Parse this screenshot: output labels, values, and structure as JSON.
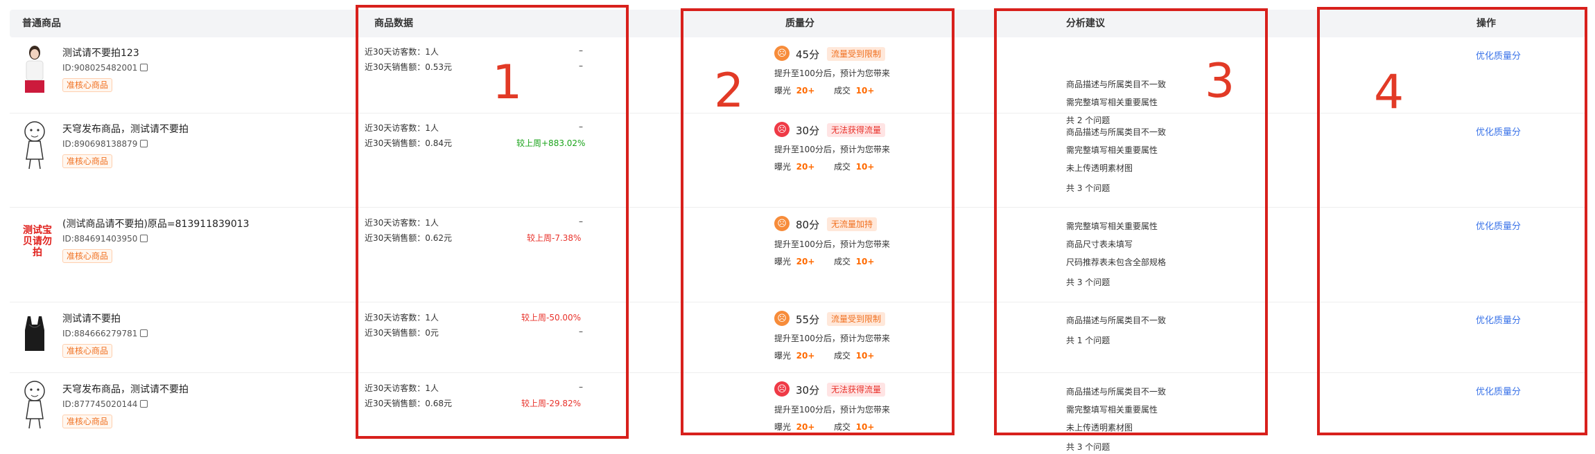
{
  "header": {
    "product": "普通商品",
    "data": "商品数据",
    "quality": "质量分",
    "suggest": "分析建议",
    "action": "操作"
  },
  "rows": [
    {
      "name": "测试请不要拍123",
      "id": "ID:908025482001",
      "tag": "准核心商品",
      "visitors_label": "近30天访客数：1人",
      "visitors_change": "–",
      "sales_label": "近30天销售额：0.53元",
      "sales_change": "–",
      "score": "45分",
      "status": "流量受到限制",
      "promo": "提升至100分后，预计为您带来",
      "exposure_label": "曝光",
      "exposure_value": "20+",
      "deal_label": "成交",
      "deal_value": "10+",
      "suggestions": [
        "商品描述与所属类目不一致",
        "需完整填写相关重要属性"
      ],
      "issue_count": "共 2 个问题",
      "action": "优化质量分"
    },
    {
      "name": "天穹发布商品，测试请不要拍",
      "id": "ID:890698138879",
      "tag": "准核心商品",
      "visitors_label": "近30天访客数：1人",
      "visitors_change": "–",
      "sales_label": "近30天销售额：0.84元",
      "sales_change": "较上周+883.02%",
      "score": "30分",
      "status": "无法获得流量",
      "promo": "提升至100分后，预计为您带来",
      "exposure_label": "曝光",
      "exposure_value": "20+",
      "deal_label": "成交",
      "deal_value": "10+",
      "suggestions": [
        "商品描述与所属类目不一致",
        "需完整填写相关重要属性",
        "未上传透明素材图"
      ],
      "issue_count": "共 3 个问题",
      "action": "优化质量分"
    },
    {
      "name": "(测试商品请不要拍)原品=813911839013",
      "thumb_text": "测试宝贝请勿拍",
      "id": "ID:884691403950",
      "tag": "准核心商品",
      "visitors_label": "近30天访客数：1人",
      "visitors_change": "–",
      "sales_label": "近30天销售额：0.62元",
      "sales_change": "较上周-7.38%",
      "score": "80分",
      "status": "无流量加持",
      "promo": "提升至100分后，预计为您带来",
      "exposure_label": "曝光",
      "exposure_value": "20+",
      "deal_label": "成交",
      "deal_value": "10+",
      "suggestions": [
        "需完整填写相关重要属性",
        "商品尺寸表未填写",
        "尺码推荐表未包含全部规格"
      ],
      "issue_count": "共 3 个问题",
      "action": "优化质量分"
    },
    {
      "name": "测试请不要拍",
      "id": "ID:884666279781",
      "tag": "准核心商品",
      "visitors_label": "近30天访客数：1人",
      "visitors_change": "较上周-50.00%",
      "sales_label": "近30天销售额：0元",
      "sales_change": "–",
      "score": "55分",
      "status": "流量受到限制",
      "promo": "提升至100分后，预计为您带来",
      "exposure_label": "曝光",
      "exposure_value": "20+",
      "deal_label": "成交",
      "deal_value": "10+",
      "suggestions": [
        "商品描述与所属类目不一致"
      ],
      "issue_count": "共 1 个问题",
      "action": "优化质量分"
    },
    {
      "name": "天穹发布商品，测试请不要拍",
      "id": "ID:877745020144",
      "tag": "准核心商品",
      "visitors_label": "近30天访客数：1人",
      "visitors_change": "–",
      "sales_label": "近30天销售额：0.68元",
      "sales_change": "较上周-29.82%",
      "score": "30分",
      "status": "无法获得流量",
      "promo": "提升至100分后，预计为您带来",
      "exposure_label": "曝光",
      "exposure_value": "20+",
      "deal_label": "成交",
      "deal_value": "10+",
      "suggestions": [
        "商品描述与所属类目不一致",
        "需完整填写相关重要属性",
        "未上传透明素材图"
      ],
      "issue_count": "共 3 个问题",
      "action": "优化质量分"
    }
  ],
  "annotations": [
    "1",
    "2",
    "3",
    "4"
  ],
  "colors": {
    "accent_blue": "#3a73e8",
    "annotation_red": "#d8201c",
    "change_up": "#1aa31a",
    "change_down": "#e8312a",
    "warning_orange": "#ff6a00"
  }
}
